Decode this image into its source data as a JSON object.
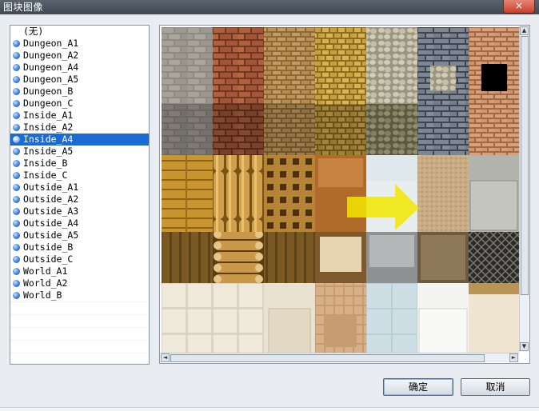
{
  "window": {
    "title": "图块图像",
    "close_glyph": "×"
  },
  "tileset_list": {
    "none_label": "(无)",
    "selected": "Inside_A4",
    "items": [
      "Dungeon_A1",
      "Dungeon_A2",
      "Dungeon_A4",
      "Dungeon_A5",
      "Dungeon_B",
      "Dungeon_C",
      "Inside_A1",
      "Inside_A2",
      "Inside_A4",
      "Inside_A5",
      "Inside_B",
      "Inside_C",
      "Outside_A1",
      "Outside_A2",
      "Outside_A3",
      "Outside_A4",
      "Outside_A5",
      "Outside_B",
      "Outside_C",
      "World_A1",
      "World_A2",
      "World_B"
    ]
  },
  "preview": {
    "scroll_up": "▲",
    "scroll_down": "▼",
    "scroll_left": "◄",
    "scroll_right": "►",
    "colors": {
      "arrow": "#f2e600"
    }
  },
  "buttons": {
    "ok": "确定",
    "cancel": "取消"
  }
}
